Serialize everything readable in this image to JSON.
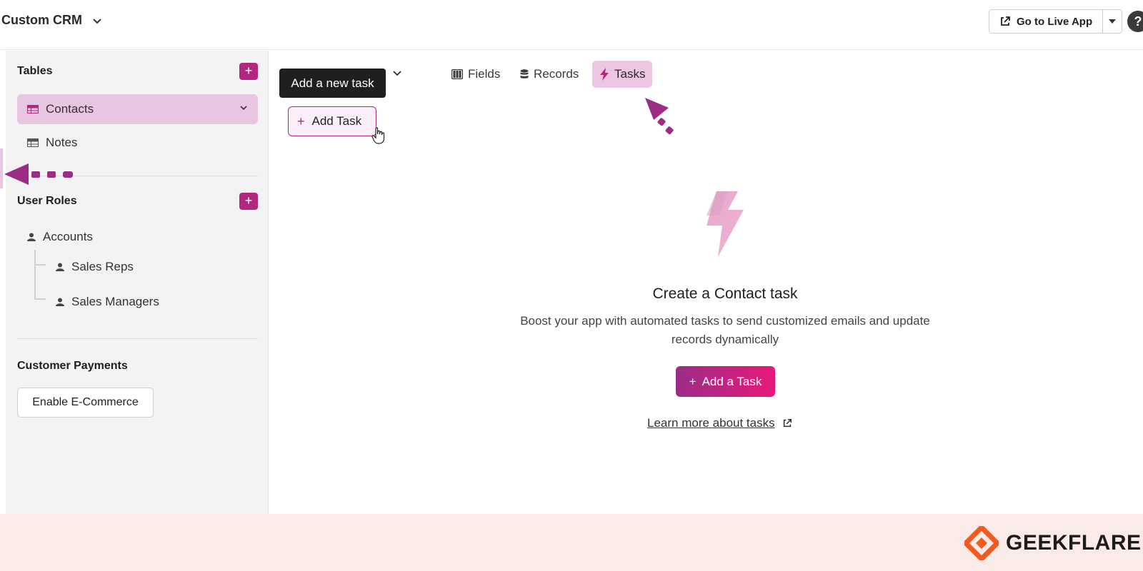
{
  "header": {
    "app_title": "Custom CRM",
    "live_app_label": "Go to Live App",
    "help_label": "?"
  },
  "sidebar": {
    "tables_title": "Tables",
    "tables": [
      {
        "label": "Contacts",
        "active": true
      },
      {
        "label": "Notes",
        "active": false
      }
    ],
    "user_roles_title": "User Roles",
    "roles": [
      {
        "label": "Accounts",
        "level": 0
      },
      {
        "label": "Sales Reps",
        "level": 1
      },
      {
        "label": "Sales Managers",
        "level": 1
      }
    ],
    "payments_title": "Customer Payments",
    "ecommerce_button": "Enable E-Commerce",
    "add_label": "+"
  },
  "main": {
    "tabs": [
      {
        "label": "Fields",
        "icon": "columns-icon",
        "active": false
      },
      {
        "label": "Records",
        "icon": "database-icon",
        "active": false
      },
      {
        "label": "Tasks",
        "icon": "lightning-icon",
        "active": true
      }
    ],
    "tooltip": "Add a new task",
    "add_task_button": "Add Task",
    "add_task_plus": "+",
    "empty_state": {
      "title": "Create a Contact task",
      "description": "Boost your app with automated tasks to send customized emails and update records dynamically",
      "cta_button": "Add a Task",
      "cta_plus": "+",
      "learn_more": "Learn more about tasks"
    }
  },
  "footer": {
    "brand": "GEEKFLARE"
  },
  "colors": {
    "accent": "#b3267e",
    "active_bg": "#e8c5e1",
    "brand_orange": "#f25a1f",
    "annotation_arrow": "#9b2d86"
  }
}
